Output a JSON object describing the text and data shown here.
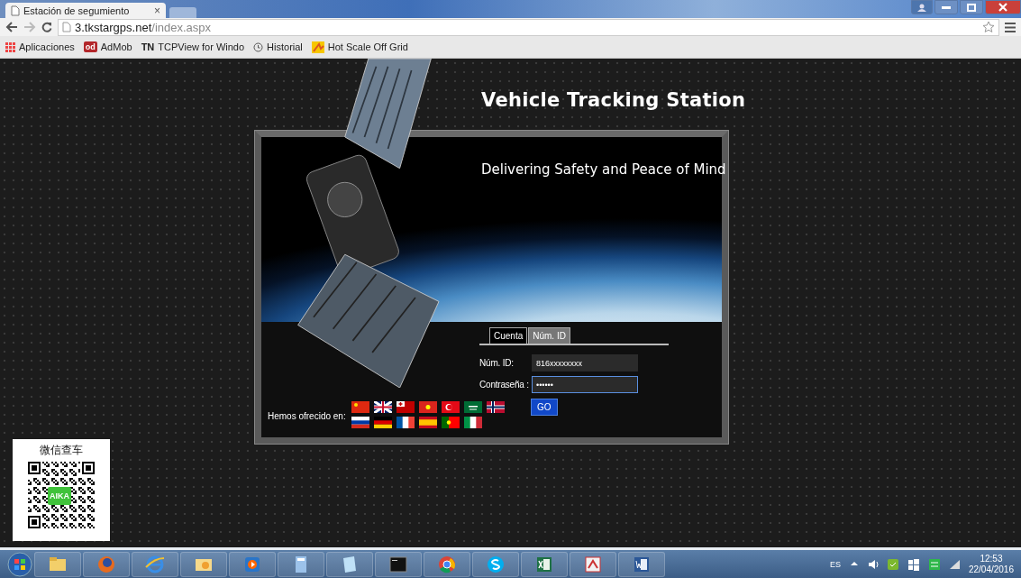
{
  "browser": {
    "tab": {
      "title": "Estación de segumiento",
      "close": "×"
    },
    "url_host": "3.tkstargps.net",
    "url_path": "/index.aspx",
    "bookmarks": [
      {
        "kind": "apps",
        "label": "Aplicaciones"
      },
      {
        "kind": "badge",
        "badge": "od",
        "label": "AdMob"
      },
      {
        "kind": "prefix",
        "badge": "TN",
        "label": "TCPView for Windo"
      },
      {
        "kind": "history",
        "label": "Historial"
      },
      {
        "kind": "image",
        "label": "Hot Scale Off Grid"
      }
    ]
  },
  "page": {
    "title": "Vehicle Tracking Station",
    "subtitle": "Delivering Safety and Peace of Mind",
    "login": {
      "tabs": [
        {
          "label": "Cuenta",
          "selected": false
        },
        {
          "label": "Núm. ID",
          "selected": true
        }
      ],
      "fields": [
        {
          "label": "Núm. ID:",
          "value": "816xxxxxxxx",
          "focused": false
        },
        {
          "label": "Contraseña :",
          "value": "••••••",
          "focused": true
        }
      ],
      "button": "GO"
    },
    "languages_label": "Hemos ofrecido en:",
    "qr_caption": "微信查车",
    "qr_badge": "AIKA"
  },
  "taskbar": {
    "language": "ES",
    "time": "12:53",
    "date": "22/04/2016"
  }
}
